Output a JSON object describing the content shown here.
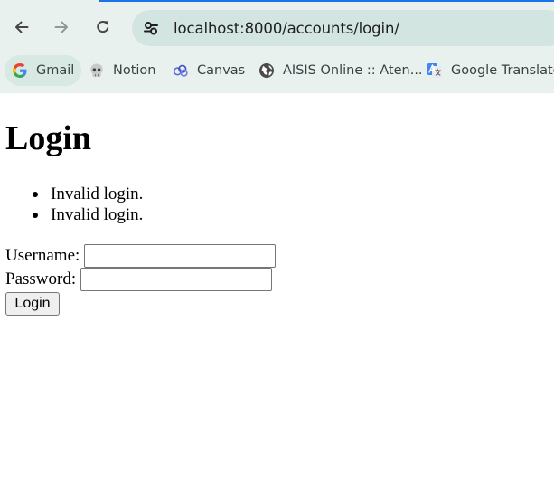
{
  "browser": {
    "address_bar": {
      "url": "localhost:8000/accounts/login/"
    },
    "bookmarks": [
      {
        "label": "Gmail",
        "icon": "google-icon"
      },
      {
        "label": "Notion",
        "icon": "skull-icon"
      },
      {
        "label": "Canvas",
        "icon": "canvas-icon"
      },
      {
        "label": "AISIS Online :: Aten...",
        "icon": "globe-icon"
      },
      {
        "label": "Google Translate",
        "icon": "translate-icon"
      }
    ],
    "colors": {
      "frame": "#e8f1ee",
      "omnibox": "#d3e5e0",
      "active_tab_indicator": "#1a73e8"
    }
  },
  "page": {
    "title": "Login",
    "errors": [
      "Invalid login.",
      "Invalid login."
    ],
    "form": {
      "username_label": "Username:",
      "username_value": "",
      "password_label": "Password:",
      "password_value": "",
      "submit_label": "Login"
    }
  }
}
